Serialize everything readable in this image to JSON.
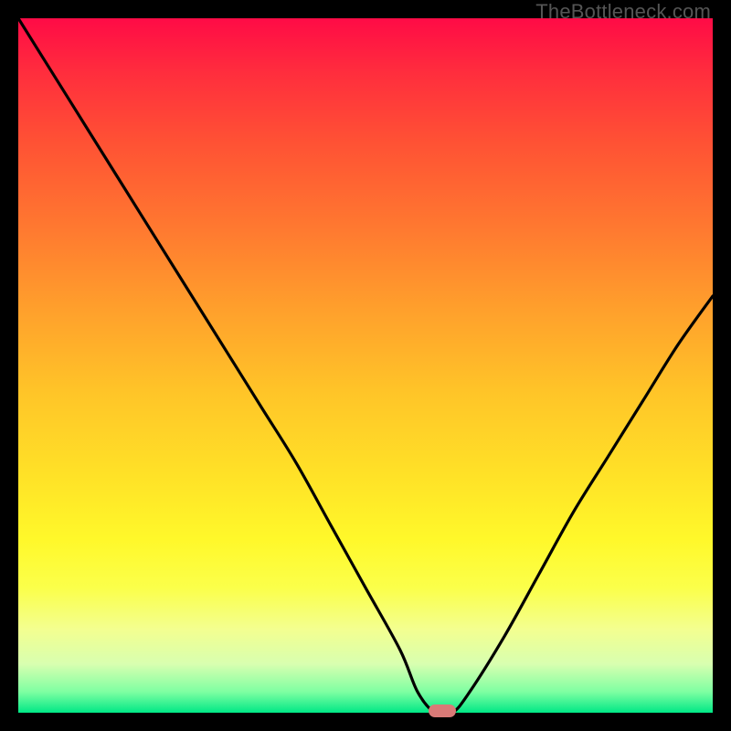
{
  "watermark": "TheBottleneck.com",
  "colors": {
    "frame": "#000000",
    "gradient_top": "#ff0b46",
    "gradient_mid": "#ffe227",
    "gradient_bottom": "#00e886",
    "curve": "#000000",
    "marker": "#d97a77"
  },
  "chart_data": {
    "type": "line",
    "title": "",
    "xlabel": "",
    "ylabel": "",
    "xlim": [
      0,
      100
    ],
    "ylim": [
      0,
      100
    ],
    "series": [
      {
        "name": "bottleneck-curve",
        "x": [
          0,
          5,
          10,
          15,
          20,
          25,
          30,
          35,
          40,
          45,
          50,
          55,
          57.5,
          60,
          62.5,
          65,
          70,
          75,
          80,
          85,
          90,
          95,
          100
        ],
        "values": [
          100,
          92,
          84,
          76,
          68,
          60,
          52,
          44,
          36,
          27,
          18,
          9,
          3,
          0,
          0,
          3,
          11,
          20,
          29,
          37,
          45,
          53,
          60
        ]
      }
    ],
    "annotations": [
      {
        "name": "optimal-marker",
        "x": 61,
        "y": 0,
        "shape": "pill"
      }
    ],
    "grid": false,
    "legend": false
  }
}
